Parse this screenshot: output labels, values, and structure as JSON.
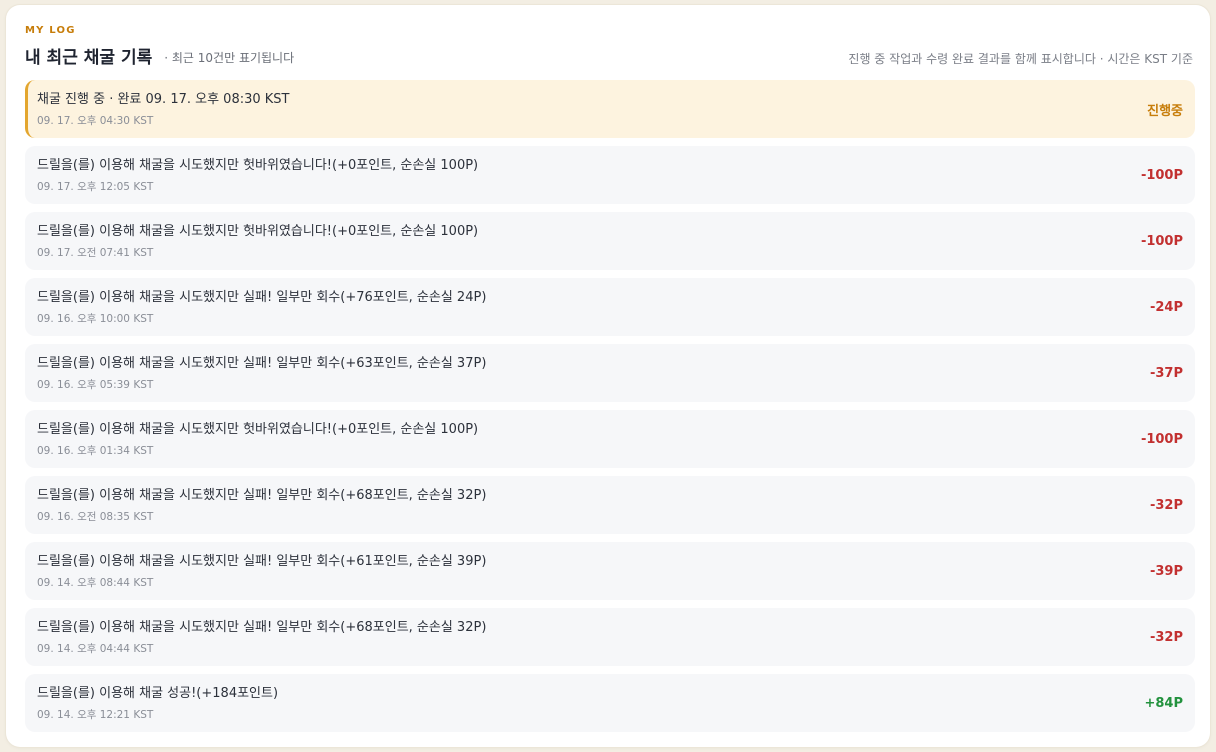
{
  "header": {
    "eyebrow": "MY LOG",
    "title": "내 최근 채굴 기록",
    "subtitle": "· 최근 10건만 표기됩니다",
    "note": "진행 중 작업과 수령 완료 결과를 함께 표시합니다 · 시간은 KST 기준"
  },
  "colors": {
    "accent": "#c77d0a",
    "loss": "#c23030",
    "gain": "#23923e",
    "pending_bg": "#fdf3df",
    "pending_border": "#e3a62f"
  },
  "logs": [
    {
      "text": "채굴 진행 중 · 완료 09. 17. 오후 08:30 KST",
      "time": "09. 17. 오후 04:30 KST",
      "result": "진행중",
      "status": "pending"
    },
    {
      "text": "드릴을(를) 이용해 채굴을 시도했지만 헛바위였습니다!(+0포인트, 순손실 100P)",
      "time": "09. 17. 오후 12:05 KST",
      "result": "-100P",
      "status": "loss"
    },
    {
      "text": "드릴을(를) 이용해 채굴을 시도했지만 헛바위였습니다!(+0포인트, 순손실 100P)",
      "time": "09. 17. 오전 07:41 KST",
      "result": "-100P",
      "status": "loss"
    },
    {
      "text": "드릴을(를) 이용해 채굴을 시도했지만 실패! 일부만 회수(+76포인트, 순손실 24P)",
      "time": "09. 16. 오후 10:00 KST",
      "result": "-24P",
      "status": "loss"
    },
    {
      "text": "드릴을(를) 이용해 채굴을 시도했지만 실패! 일부만 회수(+63포인트, 순손실 37P)",
      "time": "09. 16. 오후 05:39 KST",
      "result": "-37P",
      "status": "loss"
    },
    {
      "text": "드릴을(를) 이용해 채굴을 시도했지만 헛바위였습니다!(+0포인트, 순손실 100P)",
      "time": "09. 16. 오후 01:34 KST",
      "result": "-100P",
      "status": "loss"
    },
    {
      "text": "드릴을(를) 이용해 채굴을 시도했지만 실패! 일부만 회수(+68포인트, 순손실 32P)",
      "time": "09. 16. 오전 08:35 KST",
      "result": "-32P",
      "status": "loss"
    },
    {
      "text": "드릴을(를) 이용해 채굴을 시도했지만 실패! 일부만 회수(+61포인트, 순손실 39P)",
      "time": "09. 14. 오후 08:44 KST",
      "result": "-39P",
      "status": "loss"
    },
    {
      "text": "드릴을(를) 이용해 채굴을 시도했지만 실패! 일부만 회수(+68포인트, 순손실 32P)",
      "time": "09. 14. 오후 04:44 KST",
      "result": "-32P",
      "status": "loss"
    },
    {
      "text": "드릴을(를) 이용해 채굴 성공!(+184포인트)",
      "time": "09. 14. 오후 12:21 KST",
      "result": "+84P",
      "status": "gain"
    }
  ]
}
